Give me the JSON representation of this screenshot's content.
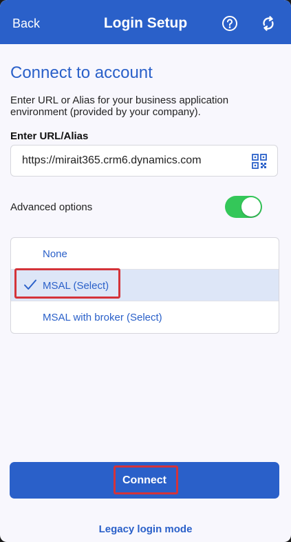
{
  "header": {
    "back_label": "Back",
    "title": "Login Setup",
    "help_icon": "help-circle-icon",
    "sync_icon": "sync-icon"
  },
  "main": {
    "heading": "Connect to account",
    "description": "Enter URL or Alias for your business application environment (provided by your company).",
    "url_label": "Enter URL/Alias",
    "url_value": "https://mirait365.crm6.dynamics.com",
    "qr_icon": "qr-code-icon",
    "advanced_label": "Advanced options",
    "advanced_enabled": true,
    "options": [
      {
        "label": "None",
        "selected": false
      },
      {
        "label": "MSAL (Select)",
        "selected": true
      },
      {
        "label": "MSAL with broker (Select)",
        "selected": false
      }
    ],
    "connect_label": "Connect",
    "legacy_label": "Legacy login mode"
  },
  "colors": {
    "accent": "#2a60c9",
    "toggle_on": "#34c759",
    "selected_row": "#dde6f7",
    "annotation": "#d43339"
  }
}
